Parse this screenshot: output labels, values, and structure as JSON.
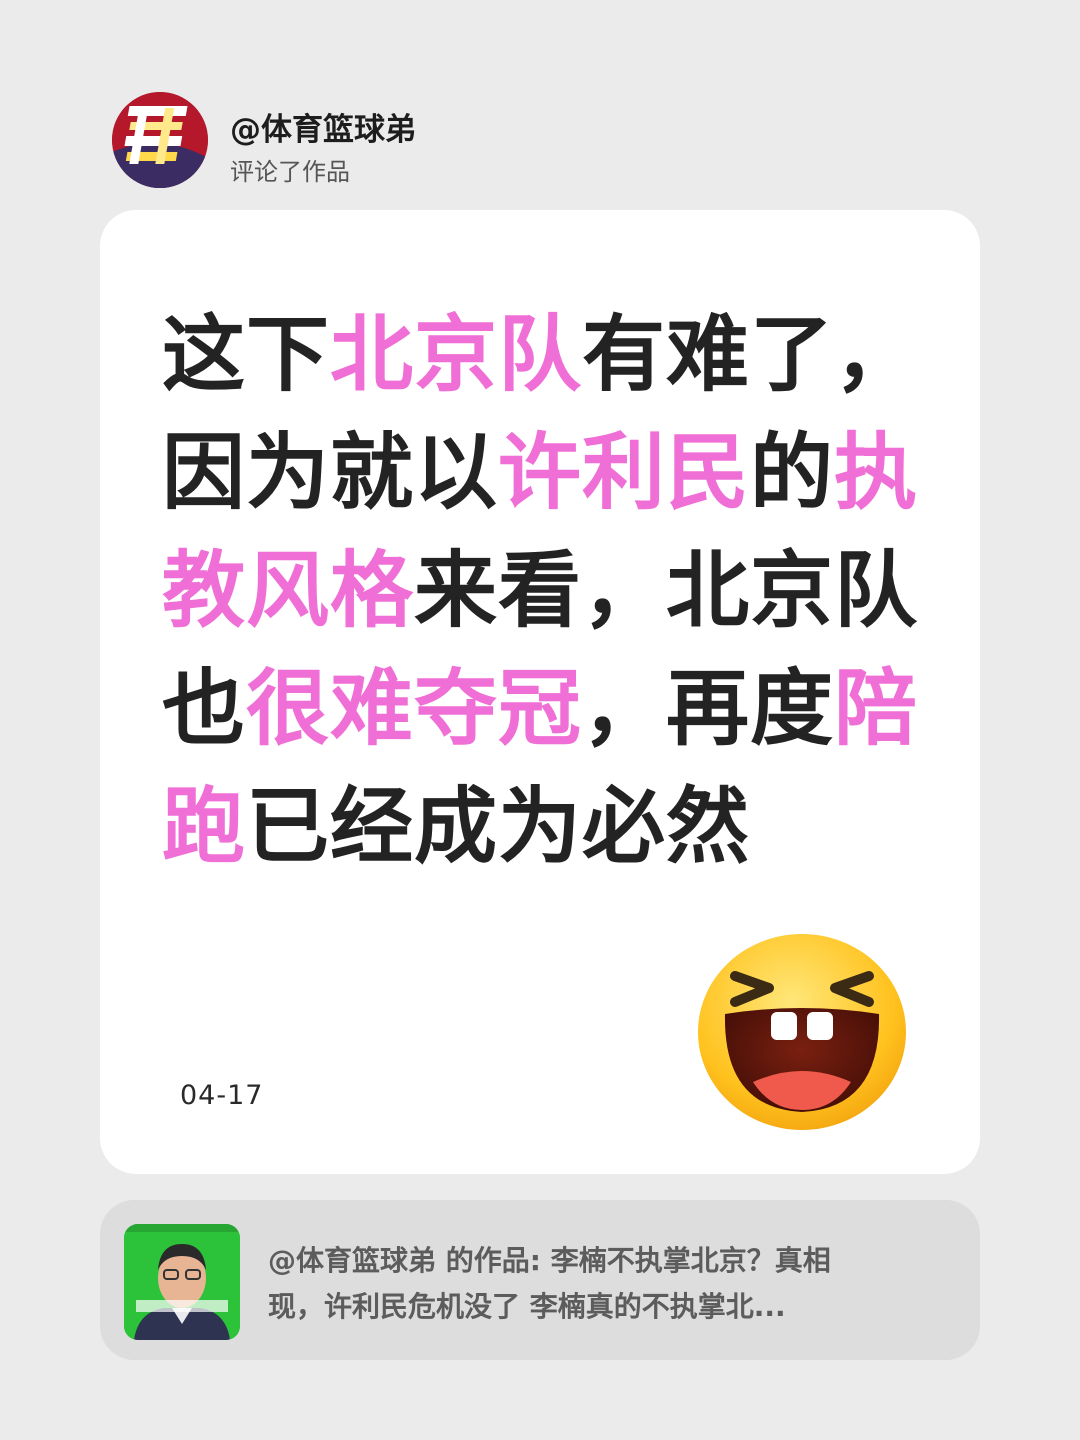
{
  "header": {
    "avatar_icon": "basketball-brand-logo-icon",
    "username": "@体育篮球弟",
    "action": "评论了作品"
  },
  "comment": {
    "segments": [
      {
        "text": "这下",
        "highlight": false
      },
      {
        "text": "北京队",
        "highlight": true
      },
      {
        "text": "有难了，因为就以",
        "highlight": false
      },
      {
        "text": "许利民",
        "highlight": true
      },
      {
        "text": "的",
        "highlight": false
      },
      {
        "text": "执教风格",
        "highlight": true
      },
      {
        "text": "来看，北京队也",
        "highlight": false
      },
      {
        "text": "很难夺冠",
        "highlight": true
      },
      {
        "text": "，再度",
        "highlight": false
      },
      {
        "text": "陪跑",
        "highlight": true
      },
      {
        "text": "已经成为必然",
        "highlight": false
      }
    ],
    "highlight_color": "#f06fd6",
    "text_color": "#232323",
    "date": "04-17",
    "emoji": "laughing-squint-emoji-icon"
  },
  "reference": {
    "thumbnail": "video-thumbnail-man-green-background",
    "line1": "@体育篮球弟 的作品: 李楠不执掌北京？真相",
    "line2": "现，许利民危机没了 李楠真的不执掌北..."
  },
  "colors": {
    "background": "#ebebeb",
    "card": "#ffffff",
    "ref_card": "#dddddd"
  }
}
